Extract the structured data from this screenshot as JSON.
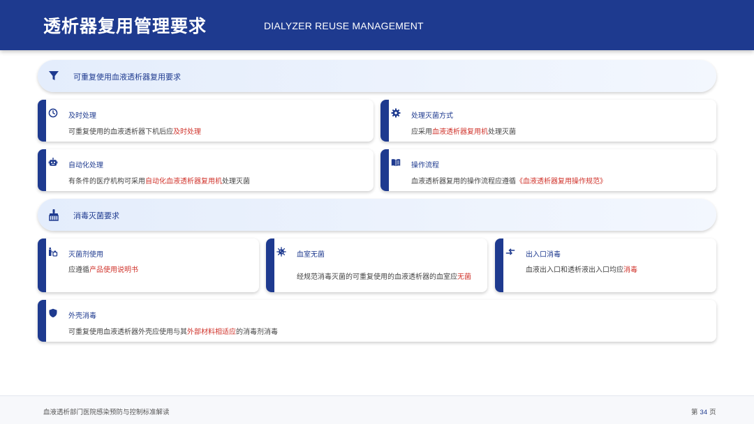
{
  "header": {
    "title": "透析器复用管理要求",
    "subtitle": "DIALYZER REUSE MANAGEMENT"
  },
  "section1": {
    "label": "可重复使用血液透析器复用要求",
    "icon": "filter-icon",
    "cards": [
      {
        "title": "及时处理",
        "icon": "clock-icon",
        "text_pre": "可重复使用的血液透析器下机后应",
        "text_hl": "及时处理",
        "text_post": ""
      },
      {
        "title": "处理灭菌方式",
        "icon": "gear-icon",
        "text_pre": "应采用",
        "text_hl": "血液透析器复用机",
        "text_post": "处理灭菌"
      },
      {
        "title": "自动化处理",
        "icon": "robot-icon",
        "text_pre": "有条件的医疗机构可采用",
        "text_hl": "自动化血液透析器复用机",
        "text_post": "处理灭菌"
      },
      {
        "title": "操作流程",
        "icon": "book-icon",
        "text_pre": "血液透析器复用的操作流程应遵循",
        "text_hl": "《血液透析器复用操作规范》",
        "text_post": ""
      }
    ]
  },
  "section2": {
    "label": "消毒灭菌要求",
    "icon": "brush-icon",
    "cards": [
      {
        "title": "灭菌剂使用",
        "icon": "bottles-icon",
        "text_pre": "应遵循",
        "text_hl": "产品使用说明书",
        "text_post": ""
      },
      {
        "title": "血室无菌",
        "icon": "virus-icon",
        "text_pre": "经规范消毒灭菌的可重复使用的血液透析器的血室应",
        "text_hl": "无菌",
        "text_post": ""
      },
      {
        "title": "出入口消毒",
        "icon": "exchange-arrows-icon",
        "text_pre": "血液出入口和透析液出入口均应",
        "text_hl": "消毒",
        "text_post": ""
      },
      {
        "title": "外壳消毒",
        "icon": "shield-icon",
        "text_pre": "可重复使用血液透析器外壳应使用与其",
        "text_hl": "外部材料相适应",
        "text_post": "的消毒剂消毒"
      }
    ]
  },
  "footer": {
    "left": "血液透析部门医院感染预防与控制标准解读",
    "page_prefix": "第",
    "page_number": "34",
    "page_suffix": "页"
  },
  "colors": {
    "primary": "#1e3a8f",
    "highlight": "#d0342c",
    "section_bg": "#e4edfc"
  }
}
